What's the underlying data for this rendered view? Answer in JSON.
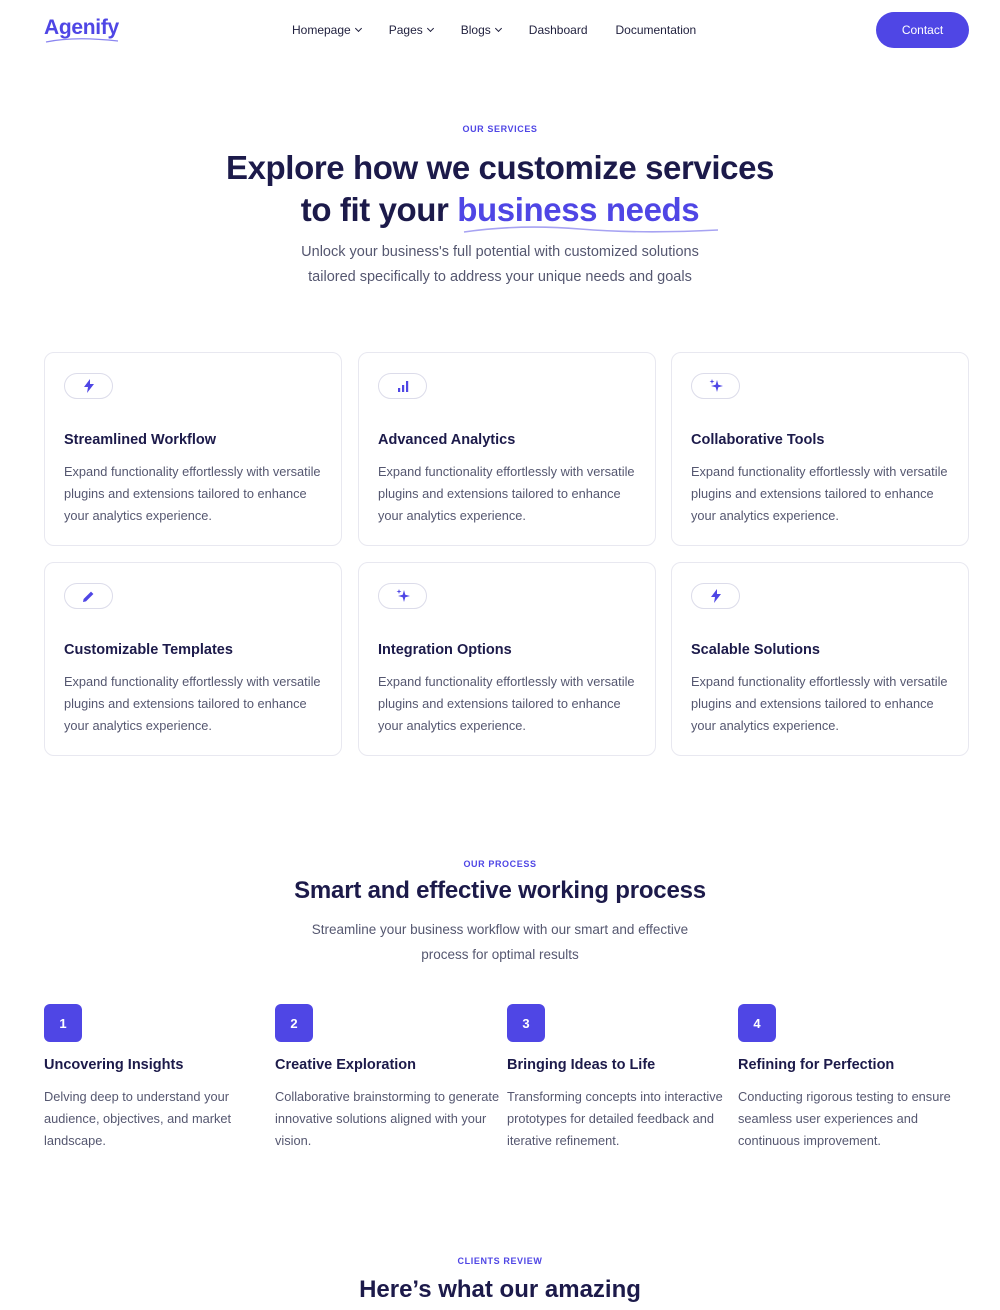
{
  "nav": {
    "logo": "Agenify",
    "items": [
      {
        "label": "Homepage",
        "has_dropdown": true
      },
      {
        "label": "Pages",
        "has_dropdown": true
      },
      {
        "label": "Blogs",
        "has_dropdown": true
      },
      {
        "label": "Dashboard",
        "has_dropdown": false
      },
      {
        "label": "Documentation",
        "has_dropdown": false
      }
    ],
    "contact_label": "Contact"
  },
  "services": {
    "eyebrow": "OUR SERVICES",
    "title_line1": "Explore how we customize services",
    "title_line2_prefix": "to fit your ",
    "title_line2_accent": "business needs",
    "subtitle_line1": "Unlock your business's full potential with customized solutions",
    "subtitle_line2": "tailored specifically to address your unique needs and goals",
    "cards": [
      {
        "icon": "bolt-icon",
        "title": "Streamlined Workflow",
        "desc": "Expand functionality effortlessly with versatile plugins and extensions tailored to enhance your analytics experience."
      },
      {
        "icon": "bar-chart-icon",
        "title": "Advanced Analytics",
        "desc": "Expand functionality effortlessly with versatile plugins and extensions tailored to enhance your analytics experience."
      },
      {
        "icon": "sparkles-icon",
        "title": "Collaborative Tools",
        "desc": "Expand functionality effortlessly with versatile plugins and extensions tailored to enhance your analytics experience."
      },
      {
        "icon": "pencil-icon",
        "title": "Customizable Templates",
        "desc": "Expand functionality effortlessly with versatile plugins and extensions tailored to enhance your analytics experience."
      },
      {
        "icon": "sparkles-icon",
        "title": "Integration Options",
        "desc": "Expand functionality effortlessly with versatile plugins and extensions tailored to enhance your analytics experience."
      },
      {
        "icon": "bolt-icon",
        "title": "Scalable Solutions",
        "desc": "Expand functionality effortlessly with versatile plugins and extensions tailored to enhance your analytics experience."
      }
    ]
  },
  "process": {
    "eyebrow": "OUR PROCESS",
    "title": "Smart and effective working process",
    "subtitle_line1": "Streamline your business workflow with our smart and effective",
    "subtitle_line2": "process for optimal results",
    "steps": [
      {
        "num": "1",
        "title": "Uncovering Insights",
        "desc": "Delving deep to understand your audience, objectives, and market landscape."
      },
      {
        "num": "2",
        "title": "Creative Exploration",
        "desc": "Collaborative brainstorming to generate innovative solutions aligned with your vision."
      },
      {
        "num": "3",
        "title": "Bringing Ideas to Life",
        "desc": "Transforming concepts into interactive prototypes for detailed feedback and iterative refinement."
      },
      {
        "num": "4",
        "title": "Refining for Perfection",
        "desc": "Conducting rigorous testing to ensure seamless user experiences and continuous improvement."
      }
    ]
  },
  "reviews": {
    "eyebrow": "CLIENTS REVIEW",
    "title": "Here’s what our amazing"
  },
  "colors": {
    "accent": "#4f46e5",
    "heading": "#1c1a4a",
    "body": "#555770"
  }
}
